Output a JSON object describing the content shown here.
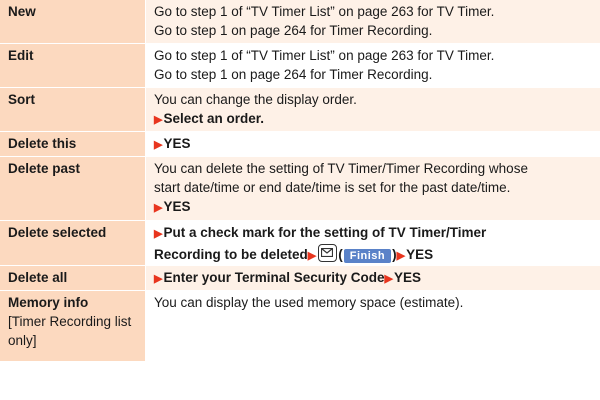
{
  "rows": [
    {
      "label": "New",
      "lines": [
        "Go to step 1 of “TV Timer List” on page 263 for TV Timer.",
        "Go to step 1 on page 264 for Timer Recording."
      ]
    },
    {
      "label": "Edit",
      "lines": [
        "Go to step 1 of “TV Timer List” on page 263 for TV Timer.",
        "Go to step 1 on page 264 for Timer Recording."
      ]
    },
    {
      "label": "Sort",
      "lines": [
        "You can change the display order."
      ],
      "action": "Select an order."
    },
    {
      "label": "Delete this",
      "action": "YES"
    },
    {
      "label": "Delete past",
      "lines": [
        "You can delete the setting of TV Timer/Timer Recording whose",
        "start date/time or end date/time is set for the past date/time."
      ],
      "action": "YES"
    },
    {
      "label": "Delete selected",
      "action_line1": "Put a check mark for the setting of TV Timer/Timer",
      "action_line2": "Recording to be deleted",
      "key_label": "Finish",
      "action_end": "YES"
    },
    {
      "label": "Delete all",
      "action": "Enter your Terminal Security Code",
      "action_end": "YES"
    },
    {
      "label": "Memory info",
      "label_sub": "[Timer Recording list only]",
      "lines": [
        "You can display the used memory space (estimate)."
      ]
    }
  ],
  "icons": {
    "arrow": "right-triangle-icon",
    "mail": "mail-key-icon"
  },
  "colors": {
    "label_bg": "#fcd9bf",
    "row_alt_bg": "#fef1e7",
    "arrow": "#e8351e",
    "finish_key": "#5a82c8"
  }
}
